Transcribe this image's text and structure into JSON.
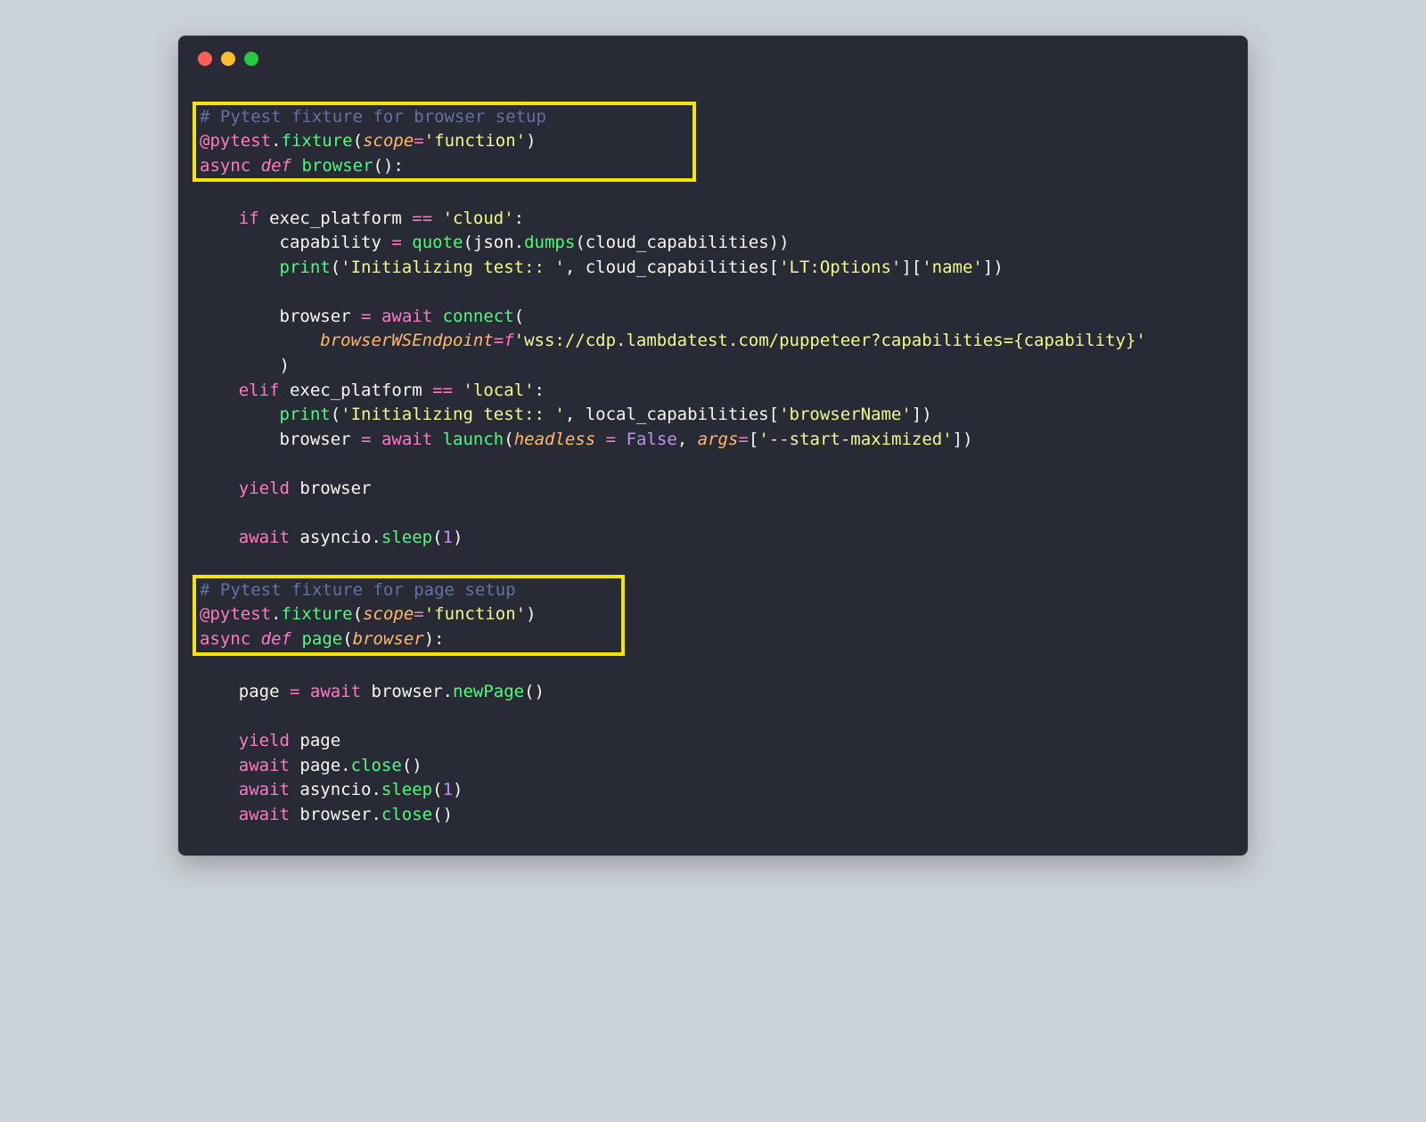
{
  "block1": {
    "comment": "# Pytest fixture for browser setup",
    "deco_at": "@pytest",
    "deco_dot": ".",
    "deco_fn": "fixture",
    "deco_open": "(",
    "deco_kw": "scope",
    "deco_eq": "=",
    "deco_val": "'function'",
    "deco_close": ")",
    "async": "async",
    "def": "def",
    "fname": "browser",
    "fsig": "():"
  },
  "body": {
    "l1_if": "if",
    "l1_var": " exec_platform ",
    "l1_eq": "==",
    "l1_str": " 'cloud'",
    "l1_colon": ":",
    "l2_lhs": "capability ",
    "l2_eq": "=",
    "l2_sp": " ",
    "l2_fn": "quote",
    "l2_open": "(json.",
    "l2_dumps": "dumps",
    "l2_tail": "(cloud_capabilities))",
    "l3_fn": "print",
    "l3_open": "(",
    "l3_str": "'Initializing test:: '",
    "l3_mid": ", cloud_capabilities[",
    "l3_k1": "'LT:Options'",
    "l3_mid2": "][",
    "l3_k2": "'name'",
    "l3_end": "])",
    "l5_lhs": "browser ",
    "l5_eq": "=",
    "l5_sp": " ",
    "l5_await": "await",
    "l5_sp2": " ",
    "l5_fn": "connect",
    "l5_open": "(",
    "l6_kw": "browserWSEndpoint",
    "l6_eq": "=",
    "l6_f": "f",
    "l6_q1": "'wss://cdp.lambdatest.com/puppeteer?capabilities=",
    "l6_br": "{capability}",
    "l6_q2": "'",
    "l7_close": ")",
    "l8_elif": "elif",
    "l8_var": " exec_platform ",
    "l8_eq": "==",
    "l8_str": " 'local'",
    "l8_colon": ":",
    "l9_fn": "print",
    "l9_open": "(",
    "l9_str": "'Initializing test:: '",
    "l9_mid": ", local_capabilities[",
    "l9_k": "'browserName'",
    "l9_end": "])",
    "l10_lhs": "browser ",
    "l10_eq": "=",
    "l10_sp": " ",
    "l10_await": "await",
    "l10_sp2": " ",
    "l10_fn": "launch",
    "l10_open": "(",
    "l10_kw1": "headless",
    "l10_sp3": " ",
    "l10_eq2": "=",
    "l10_sp4": " ",
    "l10_false": "False",
    "l10_c": ", ",
    "l10_kw2": "args",
    "l10_eq3": "=",
    "l10_br": "[",
    "l10_arg": "'--start-maximized'",
    "l10_end": "])",
    "l12_yield": "yield",
    "l12_arg": " browser",
    "l14_await": "await",
    "l14_obj": " asyncio.",
    "l14_fn": "sleep",
    "l14_open": "(",
    "l14_n": "1",
    "l14_close": ")"
  },
  "block2": {
    "comment": "# Pytest fixture for page setup",
    "deco_at": "@pytest",
    "deco_dot": ".",
    "deco_fn": "fixture",
    "deco_open": "(",
    "deco_kw": "scope",
    "deco_eq": "=",
    "deco_val": "'function'",
    "deco_close": ")",
    "async": "async",
    "def": "def",
    "fname": "page",
    "fsig_open": "(",
    "fparam": "browser",
    "fsig_close": "):"
  },
  "body2": {
    "l1_lhs": "page ",
    "l1_eq": "=",
    "l1_sp": " ",
    "l1_await": "await",
    "l1_obj": " browser.",
    "l1_fn": "newPage",
    "l1_tail": "()",
    "l3_yield": "yield",
    "l3_arg": " page",
    "l4_await": "await",
    "l4_obj": " page.",
    "l4_fn": "close",
    "l4_tail": "()",
    "l5_await": "await",
    "l5_obj": " asyncio.",
    "l5_fn": "sleep",
    "l5_open": "(",
    "l5_n": "1",
    "l5_close": ")",
    "l6_await": "await",
    "l6_obj": " browser.",
    "l6_fn": "close",
    "l6_tail": "()"
  }
}
